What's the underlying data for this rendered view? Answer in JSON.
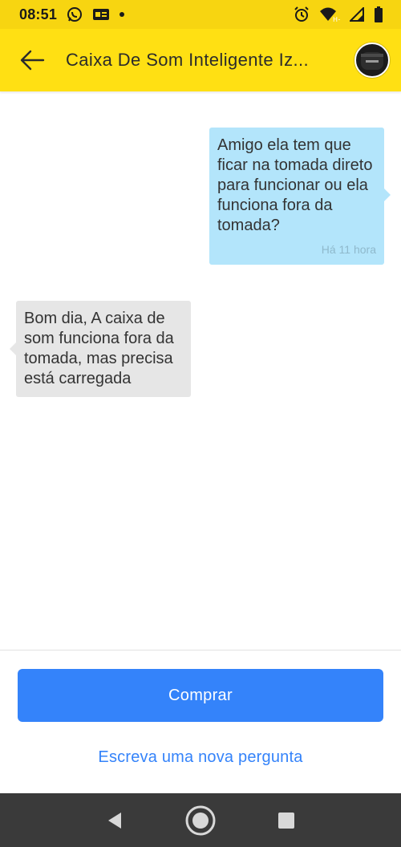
{
  "status_bar": {
    "time": "08:51",
    "icons_left": [
      "whatsapp-icon",
      "news-icon",
      "notification-dot"
    ],
    "icons_right": [
      "alarm-icon",
      "wifi-icon",
      "signal-icon",
      "battery-icon"
    ],
    "network_label": "H+"
  },
  "app_bar": {
    "title": "Caixa De Som Inteligente Iz...",
    "back_icon": "arrow-left-icon",
    "avatar_icon": "product-thumbnail"
  },
  "messages": [
    {
      "direction": "outgoing",
      "text": "Amigo ela tem que ficar na tomada direto para funcionar ou ela funciona fora da tomada?",
      "time": "Há 11 hora"
    },
    {
      "direction": "incoming",
      "text": "Bom dia, A caixa de som funciona fora da tomada, mas precisa está carregada"
    }
  ],
  "actions": {
    "buy_label": "Comprar",
    "new_question_label": "Escreva uma nova pergunta"
  },
  "nav_bar": {
    "buttons": [
      "back-triangle-icon",
      "home-circle-icon",
      "recents-square-icon"
    ]
  },
  "colors": {
    "status_bar_bg": "#F7D511",
    "app_bar_bg": "#FFE013",
    "outgoing_bubble": "#B3E5FB",
    "incoming_bubble": "#E6E6E6",
    "primary_blue": "#3483FA",
    "nav_bar_bg": "#3a3a3a"
  }
}
